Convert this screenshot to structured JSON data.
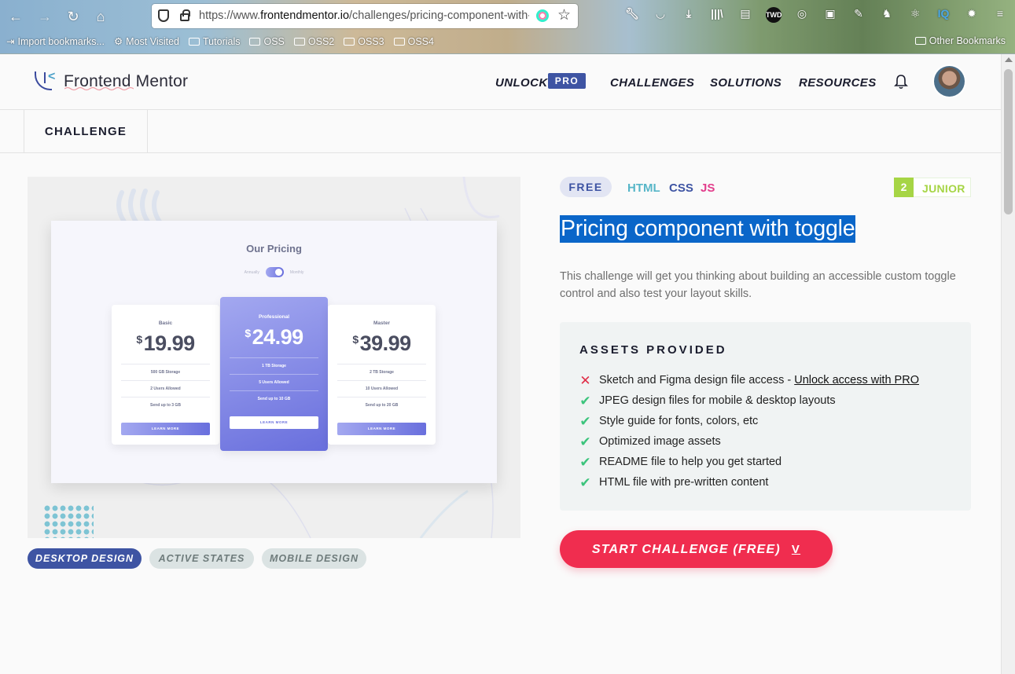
{
  "browser": {
    "url_prefix": "https://www.",
    "url_domain": "frontendmentor.io",
    "url_path": "/challenges/pricing-component-with-t",
    "toolbar_icons": [
      "wrench-icon",
      "pocket-icon",
      "download-icon",
      "library-icon",
      "reader-icon",
      "TWD",
      "globe-icon",
      "monitor-icon",
      "notes-icon",
      "gnu-icon",
      "react-icon",
      "IQ",
      "colors-icon",
      "menu-icon"
    ],
    "toolbar_labels": {
      "twd": "TWD",
      "iq": "IQ"
    },
    "bookmarks": [
      "Import bookmarks...",
      "Most Visited",
      "Tutorials",
      "OSS",
      "OSS2",
      "OSS3",
      "OSS4"
    ],
    "other_bookmarks": "Other Bookmarks"
  },
  "header": {
    "logo_text": "Frontend Mentor",
    "unlock": "UNLOCK",
    "pro": "PRO",
    "nav": [
      "CHALLENGES",
      "SOLUTIONS",
      "RESOURCES"
    ]
  },
  "subnav": {
    "tab": "CHALLENGE"
  },
  "preview": {
    "title": "Our Pricing",
    "toggle_left": "Annually",
    "toggle_right": "Monthly",
    "currency": "$",
    "cards": [
      {
        "name": "Basic",
        "price": "19.99",
        "features": [
          "500 GB Storage",
          "2 Users Allowed",
          "Send up to 3 GB"
        ],
        "button": "LEARN MORE"
      },
      {
        "name": "Professional",
        "price": "24.99",
        "features": [
          "1 TB Storage",
          "5 Users Allowed",
          "Send up to 10 GB"
        ],
        "button": "LEARN MORE"
      },
      {
        "name": "Master",
        "price": "39.99",
        "features": [
          "2 TB Storage",
          "10 Users Allowed",
          "Send up to 20 GB"
        ],
        "button": "LEARN MORE"
      }
    ],
    "tabs": [
      "DESKTOP DESIGN",
      "ACTIVE STATES",
      "MOBILE DESIGN"
    ]
  },
  "challenge": {
    "badge": "FREE",
    "langs": [
      "HTML",
      "CSS",
      "JS"
    ],
    "lang_colors": [
      "#57b6c8",
      "#3e54a3",
      "#e23d8b"
    ],
    "level_num": "2",
    "level_label": "JUNIOR",
    "title": "Pricing component with toggle",
    "description": "This challenge will get you thinking about building an accessible custom toggle control and also test your layout skills.",
    "assets_heading": "ASSETS PROVIDED",
    "assets": [
      {
        "text": "Sketch and Figma design file access - ",
        "link": "Unlock access with PRO",
        "available": false
      },
      {
        "text": "JPEG design files for mobile & desktop layouts",
        "available": true
      },
      {
        "text": "Style guide for fonts, colors, etc",
        "available": true
      },
      {
        "text": "Optimized image assets",
        "available": true
      },
      {
        "text": "README file to help you get started",
        "available": true
      },
      {
        "text": "HTML file with pre-written content",
        "available": true
      }
    ],
    "start_button": "START CHALLENGE (FREE)",
    "start_icon": "V"
  },
  "colors": {
    "brand_blue": "#3e54a3",
    "start_red": "#f02d4f",
    "junior_green": "#a6d545",
    "selection_blue": "#0a66c9"
  }
}
